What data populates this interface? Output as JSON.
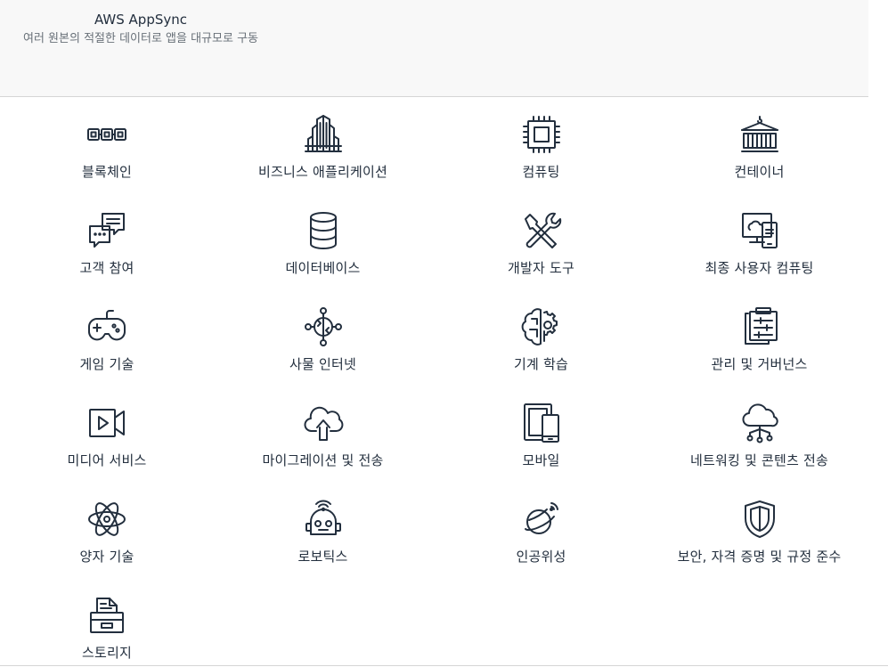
{
  "feature": {
    "title": "AWS AppSync",
    "description": "여러 원본의 적절한 데이터로 앱을 대규모로 구동"
  },
  "categories": [
    {
      "label": "블록체인",
      "icon": "blockchain-icon"
    },
    {
      "label": "비즈니스 애플리케이션",
      "icon": "buildings-icon"
    },
    {
      "label": "컴퓨팅",
      "icon": "chip-icon"
    },
    {
      "label": "컨테이너",
      "icon": "container-icon"
    },
    {
      "label": "고객 참여",
      "icon": "chat-bubbles-icon"
    },
    {
      "label": "데이터베이스",
      "icon": "database-icon"
    },
    {
      "label": "개발자 도구",
      "icon": "tools-icon"
    },
    {
      "label": "최종 사용자 컴퓨팅",
      "icon": "desktop-cloud-icon"
    },
    {
      "label": "게임 기술",
      "icon": "gamepad-icon"
    },
    {
      "label": "사물 인터넷",
      "icon": "iot-icon"
    },
    {
      "label": "기계 학습",
      "icon": "brain-gear-icon"
    },
    {
      "label": "관리 및 거버넌스",
      "icon": "clipboard-sliders-icon"
    },
    {
      "label": "미디어 서비스",
      "icon": "video-camera-icon"
    },
    {
      "label": "마이그레이션 및 전송",
      "icon": "cloud-upload-icon"
    },
    {
      "label": "모바일",
      "icon": "tablet-phone-icon"
    },
    {
      "label": "네트워킹 및 콘텐츠 전송",
      "icon": "cloud-network-icon"
    },
    {
      "label": "양자 기술",
      "icon": "atom-icon"
    },
    {
      "label": "로보틱스",
      "icon": "robot-icon"
    },
    {
      "label": "인공위성",
      "icon": "satellite-planet-icon"
    },
    {
      "label": "보안, 자격 증명 및 규정 준수",
      "icon": "shield-icon"
    },
    {
      "label": "스토리지",
      "icon": "storage-file-icon"
    }
  ]
}
